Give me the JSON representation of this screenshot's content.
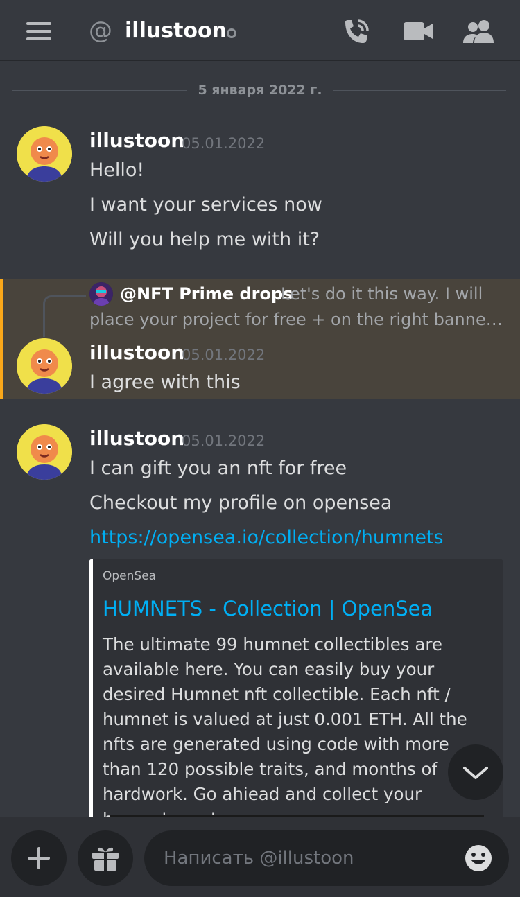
{
  "header": {
    "at_symbol": "@",
    "title": "illustoon",
    "icons": [
      "hamburger-icon",
      "at-icon",
      "phone-call-icon",
      "video-icon",
      "members-icon"
    ]
  },
  "divider": {
    "date": "5 января 2022 г."
  },
  "messages": [
    {
      "author": "illustoon",
      "timestamp": "05.01.2022",
      "lines": [
        "Hello!",
        "I want your services now",
        "Will you help me with it?"
      ]
    },
    {
      "author": "illustoon",
      "timestamp": "05.01.2022",
      "reply": {
        "author": "@NFT Prime drops",
        "text_line1": "Let's do it this way.  I will",
        "text_line2": "place your project for free + on the right banner o…"
      },
      "lines": [
        "I agree with this"
      ]
    },
    {
      "author": "illustoon",
      "timestamp": "05.01.2022",
      "lines": [
        "I can gift you an nft for free",
        "Checkout my profile on opensea"
      ],
      "link": "https://opensea.io/collection/humnets",
      "embed": {
        "provider": "OpenSea",
        "title": "HUMNETS - Collection | OpenSea",
        "description": "The ultimate 99 humnet collectibles are available here. You can easily buy your desired Humnet nft collectible. Each nft / humnet is valued at just 0.001 ETH. All the nfts are generated using code with more than 120 possible traits, and months of hardwork. Go ahiead and collect your humnet creatures."
      }
    }
  ],
  "composer": {
    "placeholder": "Написать @illustoon"
  },
  "colors": {
    "background": "#36393f",
    "bar": "#2f3136",
    "accent_link": "#00aff4",
    "mention_highlight": "#faa81a"
  }
}
